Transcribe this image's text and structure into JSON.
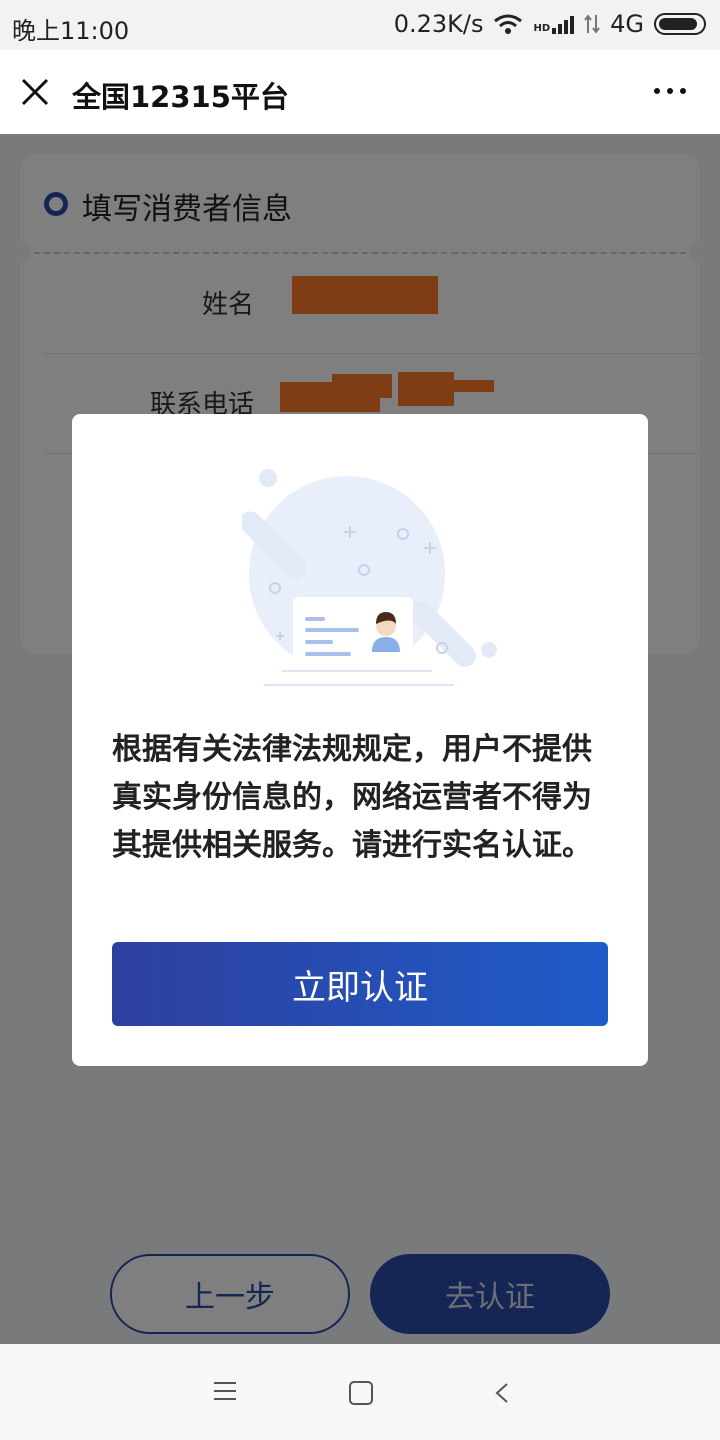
{
  "status_bar": {
    "time": "晚上11:00",
    "net_speed": "0.23K/s",
    "hd_label": "HD",
    "network": "4G",
    "icons": [
      "wifi-icon",
      "signal-icon",
      "data-arrows-icon",
      "battery-icon"
    ]
  },
  "header": {
    "title": "全国12315平台",
    "close_icon": "close-icon",
    "more_icon": "more-icon"
  },
  "form": {
    "section_title": "填写消费者信息",
    "fields": [
      {
        "label": "姓名"
      },
      {
        "label": "联系电话"
      }
    ]
  },
  "footer": {
    "prev_label": "上一步",
    "verify_label": "去认证"
  },
  "nav": {
    "icons": [
      "menu-icon",
      "home-icon",
      "back-icon"
    ]
  },
  "modal": {
    "message": "根据有关法律法规规定，用户不提供真实身份信息的，网络运营者不得为其提供相关服务。请进行实名认证。",
    "button_label": "立即认证"
  },
  "colors": {
    "primary": "#2b4aa8",
    "button_gradient_start": "#2e3f9e",
    "button_gradient_end": "#1f5cc9",
    "redaction": "#ff7a2b"
  }
}
